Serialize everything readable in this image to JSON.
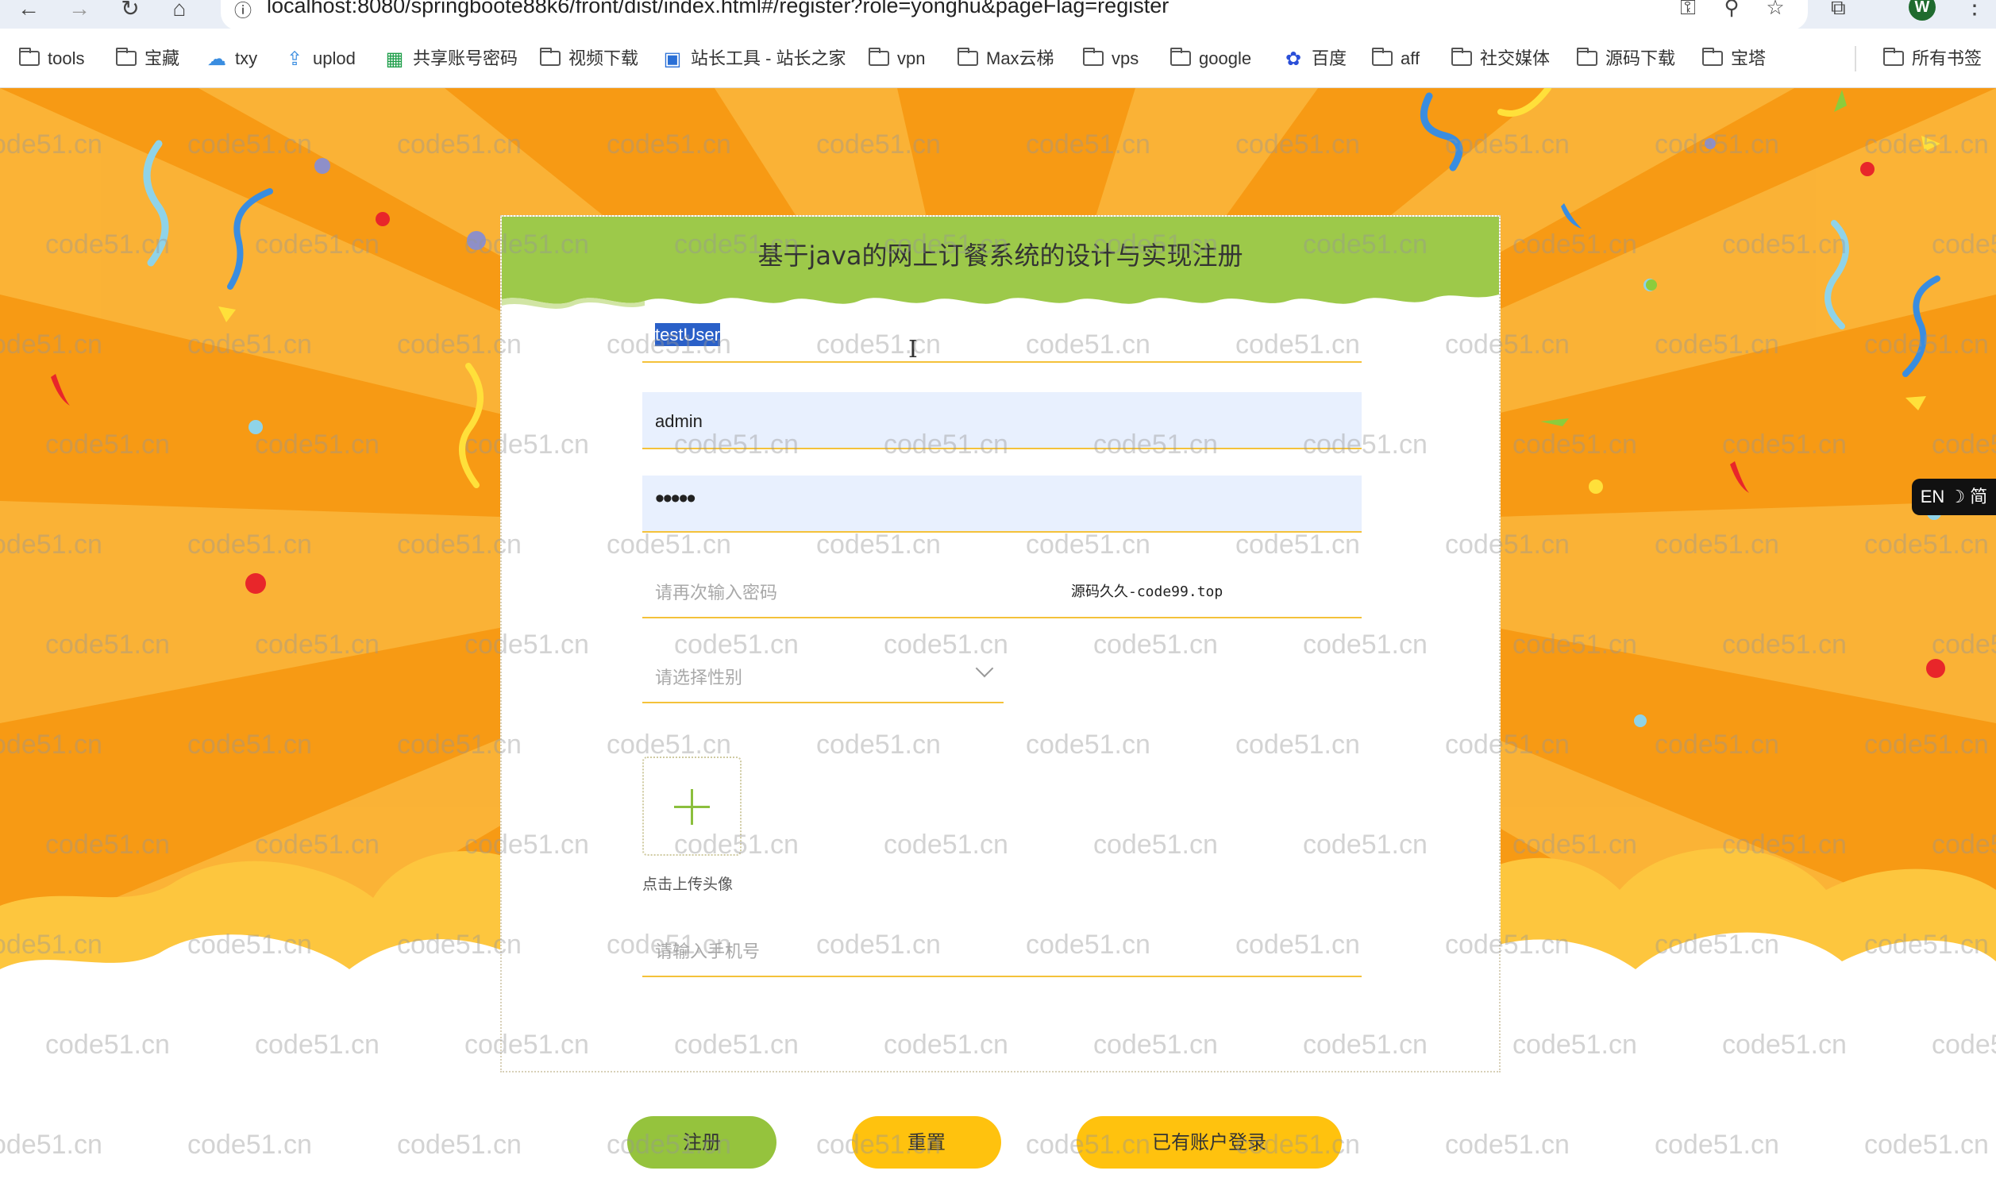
{
  "browser": {
    "url": "localhost:8080/springboote88k6/front/dist/index.html#/register?role=yonghu&pageFlag=register",
    "profile_initial": "W",
    "nav_icons": [
      "back-icon",
      "forward-icon",
      "reload-icon",
      "home-icon"
    ],
    "omnibox_icons": [
      "key-icon",
      "zoom-icon",
      "star-icon"
    ],
    "bookmarks": [
      {
        "label": "tools",
        "icon": "folder-icon"
      },
      {
        "label": "宝藏",
        "icon": "folder-icon"
      },
      {
        "label": "txy",
        "icon": "cloud-icon"
      },
      {
        "label": "uplod",
        "icon": "upload-icon"
      },
      {
        "label": "共享账号密码",
        "icon": "sheet-icon"
      },
      {
        "label": "视频下载",
        "icon": "folder-icon"
      },
      {
        "label": "站长工具 - 站长之家",
        "icon": "tools-icon"
      },
      {
        "label": "vpn",
        "icon": "folder-icon"
      },
      {
        "label": "Max云梯",
        "icon": "folder-icon"
      },
      {
        "label": "vps",
        "icon": "folder-icon"
      },
      {
        "label": "google",
        "icon": "folder-icon"
      },
      {
        "label": "百度",
        "icon": "baidu-icon"
      },
      {
        "label": "aff",
        "icon": "folder-icon"
      },
      {
        "label": "社交媒体",
        "icon": "folder-icon"
      },
      {
        "label": "源码下载",
        "icon": "folder-icon"
      },
      {
        "label": "宝塔",
        "icon": "folder-icon"
      }
    ],
    "all_bookmarks": "所有书签"
  },
  "watermark": "code51.cn",
  "form": {
    "title": "基于java的网上订餐系统的设计与实现注册",
    "account_value": "testUser",
    "username_value": "admin",
    "password_dots": "•••••",
    "confirm_placeholder": "请再次输入密码",
    "overlay_text": "源码久久-code99.top",
    "gender_placeholder": "请选择性别",
    "upload_label": "点击上传头像",
    "phone_placeholder": "请输入手机号"
  },
  "buttons": {
    "register": "注册",
    "reset": "重置",
    "login": "已有账户登录"
  },
  "ime": "EN ☽ 简",
  "colors": {
    "header_green": "#9dc94a",
    "register_button": "#95c33d",
    "secondary_button": "#ffc20e",
    "field_underline": "#f4c23a",
    "background_orange": "#f8a11e"
  }
}
